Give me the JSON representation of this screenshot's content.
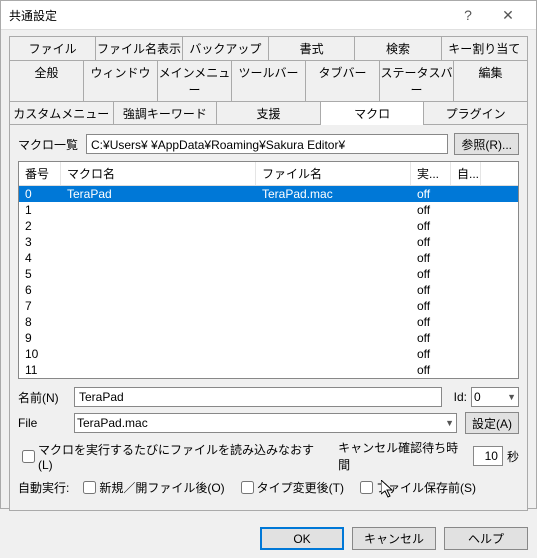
{
  "window": {
    "title": "共通設定"
  },
  "tabs_row1": [
    "ファイル",
    "ファイル名表示",
    "バックアップ",
    "書式",
    "検索",
    "キー割り当て"
  ],
  "tabs_row2": [
    "全般",
    "ウィンドウ",
    "メインメニュー",
    "ツールバー",
    "タブバー",
    "ステータスバー",
    "編集"
  ],
  "tabs_row3": [
    "カスタムメニュー",
    "強調キーワード",
    "支援",
    "マクロ",
    "プラグイン"
  ],
  "tabs_active": "マクロ",
  "macrolist_label": "マクロ一覧",
  "path_value": "C:¥Users¥         ¥AppData¥Roaming¥Sakura Editor¥",
  "browse_btn": "参照(R)...",
  "columns": {
    "num": "番号",
    "name": "マクロ名",
    "file": "ファイル名",
    "exec": "実...",
    "auto": "自..."
  },
  "rows": [
    {
      "num": "0",
      "name": "TeraPad",
      "file": "TeraPad.mac",
      "exec": "off",
      "auto": ""
    },
    {
      "num": "1",
      "name": "",
      "file": "",
      "exec": "off",
      "auto": ""
    },
    {
      "num": "2",
      "name": "",
      "file": "",
      "exec": "off",
      "auto": ""
    },
    {
      "num": "3",
      "name": "",
      "file": "",
      "exec": "off",
      "auto": ""
    },
    {
      "num": "4",
      "name": "",
      "file": "",
      "exec": "off",
      "auto": ""
    },
    {
      "num": "5",
      "name": "",
      "file": "",
      "exec": "off",
      "auto": ""
    },
    {
      "num": "6",
      "name": "",
      "file": "",
      "exec": "off",
      "auto": ""
    },
    {
      "num": "7",
      "name": "",
      "file": "",
      "exec": "off",
      "auto": ""
    },
    {
      "num": "8",
      "name": "",
      "file": "",
      "exec": "off",
      "auto": ""
    },
    {
      "num": "9",
      "name": "",
      "file": "",
      "exec": "off",
      "auto": ""
    },
    {
      "num": "10",
      "name": "",
      "file": "",
      "exec": "off",
      "auto": ""
    },
    {
      "num": "11",
      "name": "",
      "file": "",
      "exec": "off",
      "auto": ""
    }
  ],
  "form": {
    "name_label": "名前(N)",
    "name_value": "TeraPad",
    "file_label": "File",
    "file_value": "TeraPad.mac",
    "id_label": "Id:",
    "id_value": "0",
    "set_btn": "設定(A)",
    "reload_chk": "マクロを実行するたびにファイルを読み込みなおす(L)",
    "cancel_wait_label": "キャンセル確認待ち時間",
    "cancel_wait_value": "10",
    "cancel_wait_unit": "秒",
    "autoexec_label": "自動実行:",
    "chk_open": "新規／開ファイル後(O)",
    "chk_type": "タイプ変更後(T)",
    "chk_save": "ファイル保存前(S)"
  },
  "footer": {
    "ok": "OK",
    "cancel": "キャンセル",
    "help": "ヘルプ"
  }
}
